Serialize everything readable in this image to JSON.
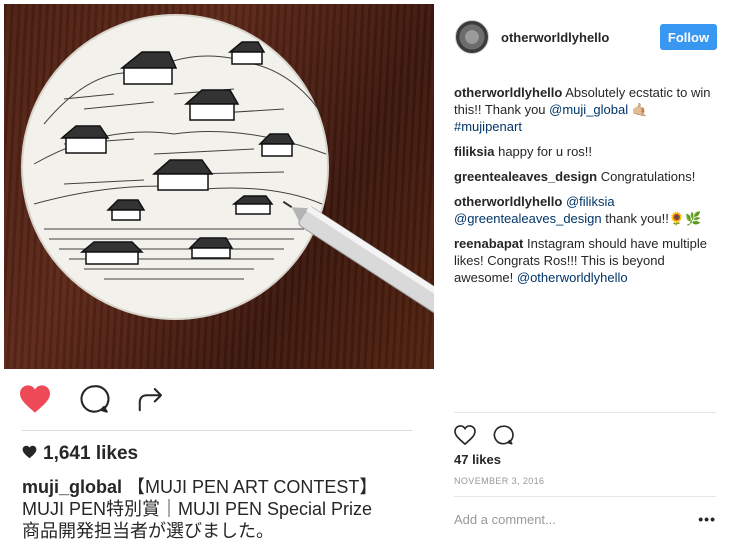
{
  "post": {
    "likes_count": "1,641 likes",
    "caption_user": "muji_global",
    "caption_line1": "【MUJI PEN ART CONTEST】",
    "caption_line2": "MUJI PEN特別賞｜MUJI PEN Special Prize",
    "caption_line3": "商品開発担当者が選びました。"
  },
  "sidebar": {
    "username": "otherworldlyhello",
    "follow_label": "Follow",
    "comments": [
      {
        "user": "otherworldlyhello",
        "pre": "Absolutely ecstatic to win this!! Thank you ",
        "mention": "@muji_global",
        "emoji": "🤙🏼",
        "mention2": "#mujipenart",
        "post": ""
      },
      {
        "user": "filiksia",
        "pre": "happy for u ros!!",
        "mention": "",
        "emoji": "",
        "mention2": "",
        "post": ""
      },
      {
        "user": "greentealeaves_design",
        "pre": "Congratulations!",
        "mention": "",
        "emoji": "",
        "mention2": "",
        "post": ""
      },
      {
        "user": "otherworldlyhello",
        "pre": "",
        "mention": "@filiksia",
        "emoji": "",
        "mention2": "@greentealeaves_design",
        "post": " thank you!!🌻🌿"
      },
      {
        "user": "reenabapat",
        "pre": "Instagram should have multiple likes! Congrats Ros!!! This is beyond awesome! ",
        "mention": "@otherworldlyhello",
        "emoji": "",
        "mention2": "",
        "post": ""
      }
    ],
    "likes": "47 likes",
    "date": "NOVEMBER 3, 2016",
    "comment_placeholder": "Add a comment...",
    "more": "•••"
  },
  "colors": {
    "like_red": "#ed4956",
    "follow_blue": "#3897f0",
    "mention_blue": "#003569"
  },
  "icons": [
    "heart-filled-icon",
    "comment-icon",
    "share-icon",
    "heart-outline-icon",
    "comment-icon",
    "options-icon"
  ]
}
